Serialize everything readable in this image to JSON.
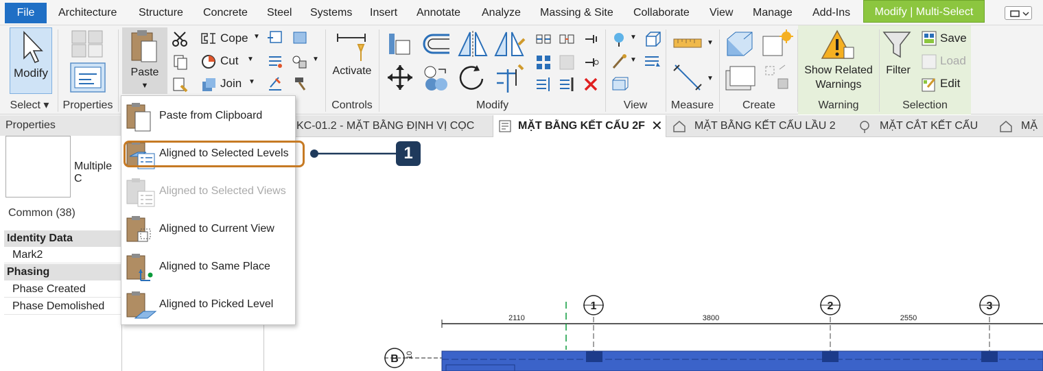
{
  "menubar": {
    "file": "File",
    "tabs": [
      "Architecture",
      "Structure",
      "Concrete",
      "Steel",
      "Systems",
      "Insert",
      "Annotate",
      "Analyze",
      "Massing & Site",
      "Collaborate",
      "View",
      "Manage",
      "Add-Ins"
    ],
    "context_tab": "Modify | Multi-Select"
  },
  "ribbon": {
    "select": {
      "modify": "Modify",
      "label": "Select"
    },
    "properties": {
      "label": "Properties"
    },
    "clipboard": {
      "paste": "Paste"
    },
    "geometry": {
      "cope": "Cope",
      "cut": "Cut",
      "join": "Join"
    },
    "controls": {
      "activate": "Activate",
      "label": "Controls"
    },
    "modify": {
      "label": "Modify"
    },
    "view": {
      "label": "View"
    },
    "measure": {
      "label": "Measure"
    },
    "create": {
      "label": "Create"
    },
    "warning": {
      "show_related_line1": "Show Related",
      "show_related_line2": "Warnings",
      "label": "Warning"
    },
    "selection": {
      "filter": "Filter",
      "save": "Save",
      "load": "Load",
      "edit": "Edit",
      "label": "Selection"
    }
  },
  "view_tabs": [
    {
      "label": "KC-01.2 - MẶT BẰNG ĐỊNH VỊ CỌC"
    },
    {
      "label": "MẶT BẰNG KẾT CẤU 2F",
      "active": true
    },
    {
      "label": "MẶT BẰNG KẾT CẤU LẦU 2"
    },
    {
      "label": "MẶT CẮT KẾT CẤU"
    },
    {
      "label": "MẶ"
    }
  ],
  "properties": {
    "title": "Properties",
    "type_label": "Multiple C",
    "filter_label": "Common (38)",
    "groups": [
      {
        "name": "Identity Data",
        "rows": [
          "Mark2"
        ]
      },
      {
        "name": "Phasing",
        "rows": [
          "Phase Created",
          "Phase Demolished"
        ]
      }
    ]
  },
  "paste_menu": {
    "items": [
      {
        "label": "Paste from Clipboard",
        "enabled": true,
        "icon": "paste-clipboard-icon"
      },
      {
        "label": "Aligned to Selected Levels",
        "enabled": true,
        "icon": "paste-levels-icon",
        "highlighted": true
      },
      {
        "label": "Aligned to Selected Views",
        "enabled": false,
        "icon": "paste-views-icon"
      },
      {
        "label": "Aligned to Current View",
        "enabled": true,
        "icon": "paste-current-view-icon"
      },
      {
        "label": "Aligned to Same Place",
        "enabled": true,
        "icon": "paste-same-place-icon"
      },
      {
        "label": "Aligned to Picked Level",
        "enabled": true,
        "icon": "paste-picked-level-icon"
      }
    ]
  },
  "callout": {
    "number": "1",
    "color": "#1f3a5c",
    "highlight_color": "#c67a24"
  },
  "drawing": {
    "grid_labels": [
      "1",
      "2",
      "3"
    ],
    "row_label": "B",
    "dimensions": [
      "2110",
      "3800",
      "2550"
    ],
    "row_dim": "10"
  },
  "colors": {
    "file_tab": "#1f6fc5",
    "context_tab": "#8cc63f",
    "warning_panel": "#e6f0db",
    "beam_fill": "#3b63c9"
  }
}
